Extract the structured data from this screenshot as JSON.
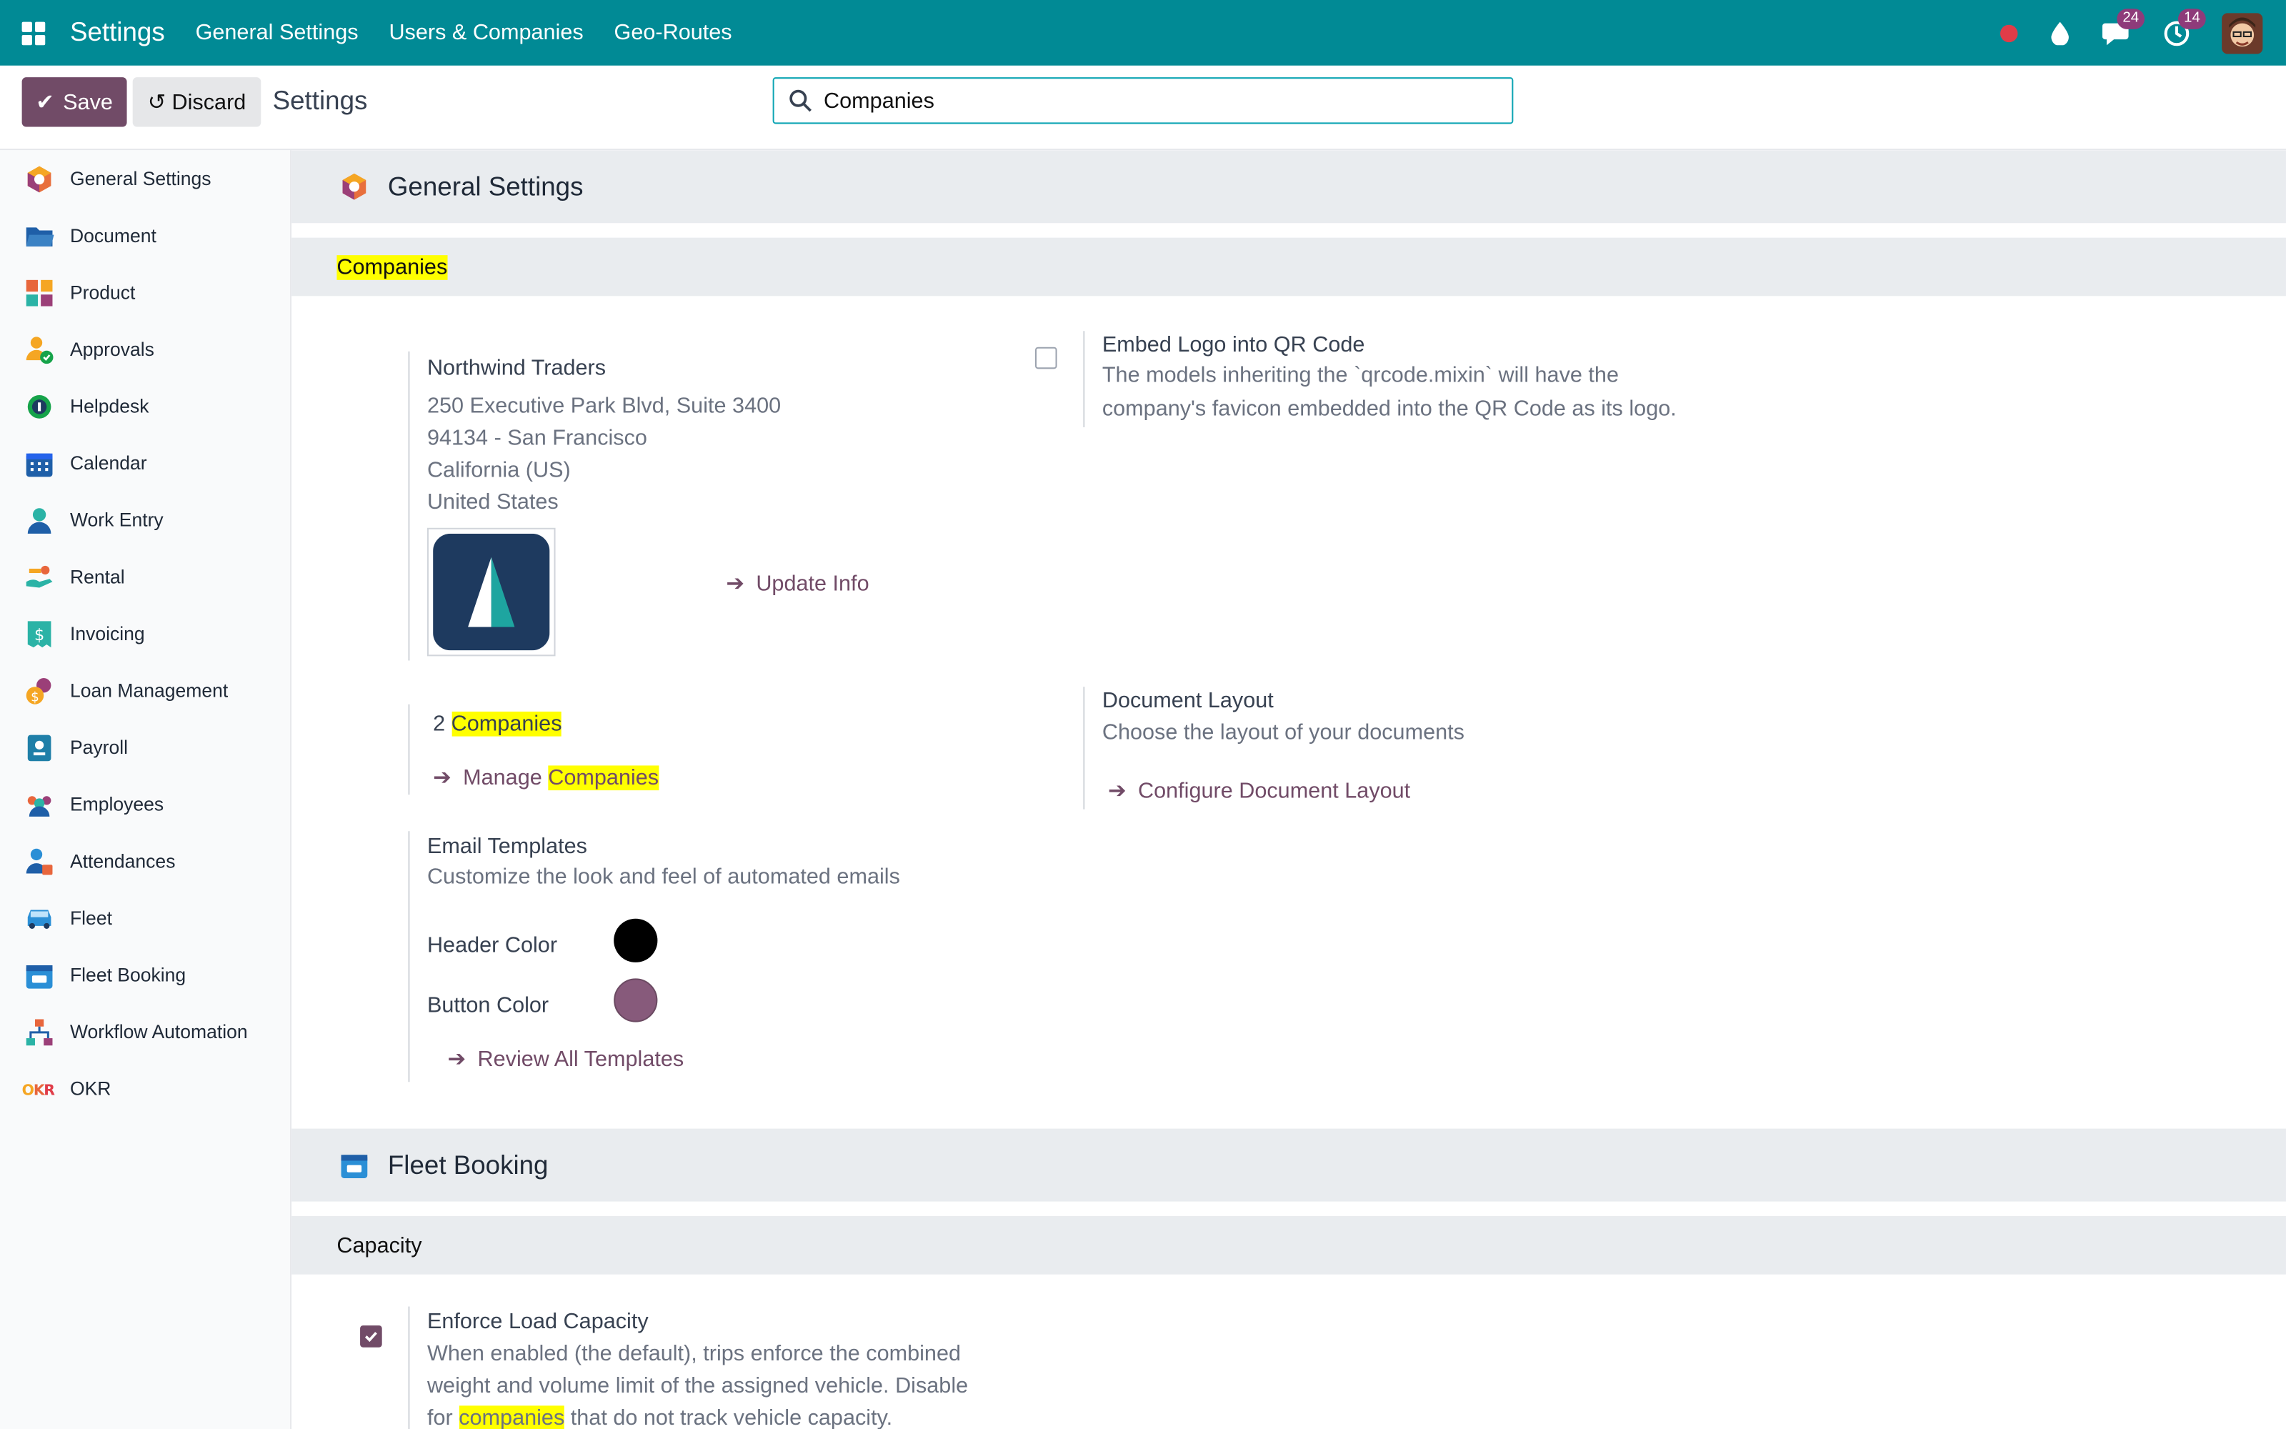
{
  "navbar": {
    "brand": "Settings",
    "menus": [
      "General Settings",
      "Users & Companies",
      "Geo-Routes"
    ],
    "chat_badge": "24",
    "activity_badge": "14",
    "bg_color": "#018a95"
  },
  "control": {
    "save_label": "Save",
    "discard_label": "Discard",
    "title": "Settings",
    "search_value": "Companies"
  },
  "sidebar": {
    "items": [
      {
        "label": "General Settings",
        "icon": "general-settings-icon"
      },
      {
        "label": "Document",
        "icon": "folder-icon"
      },
      {
        "label": "Product",
        "icon": "product-icon"
      },
      {
        "label": "Approvals",
        "icon": "approvals-icon"
      },
      {
        "label": "Helpdesk",
        "icon": "helpdesk-icon"
      },
      {
        "label": "Calendar",
        "icon": "calendar-icon"
      },
      {
        "label": "Work Entry",
        "icon": "work-entry-icon"
      },
      {
        "label": "Rental",
        "icon": "rental-icon"
      },
      {
        "label": "Invoicing",
        "icon": "invoicing-icon"
      },
      {
        "label": "Loan Management",
        "icon": "loan-icon"
      },
      {
        "label": "Payroll",
        "icon": "payroll-icon"
      },
      {
        "label": "Employees",
        "icon": "employees-icon"
      },
      {
        "label": "Attendances",
        "icon": "attendances-icon"
      },
      {
        "label": "Fleet",
        "icon": "fleet-icon"
      },
      {
        "label": "Fleet Booking",
        "icon": "fleet-booking-icon"
      },
      {
        "label": "Workflow Automation",
        "icon": "workflow-icon"
      },
      {
        "label": "OKR",
        "icon": "okr-icon"
      }
    ]
  },
  "general": {
    "title": "General Settings",
    "section_title": "Companies",
    "company": {
      "name": "Northwind Traders",
      "address1": "250 Executive Park Blvd, Suite 3400",
      "address2": "94134 - San Francisco",
      "address3": "California (US)",
      "address4": "United States",
      "update_link": "Update Info"
    },
    "qr": {
      "title": "Embed Logo into QR Code",
      "desc1": "The models inheriting the `qrcode.mixin` will have the",
      "desc2": "company's favicon embedded into the QR Code as its logo.",
      "checked": false
    },
    "companies": {
      "count": "2",
      "count_label": "Companies",
      "manage_prefix": "Manage",
      "manage_hl": "Companies"
    },
    "doc_layout": {
      "title": "Document Layout",
      "desc": "Choose the layout of your documents",
      "link": "Configure Document Layout"
    },
    "email": {
      "title": "Email Templates",
      "desc": "Customize the look and feel of automated emails",
      "header_label": "Header Color",
      "header_color": "#000000",
      "button_label": "Button Color",
      "button_color": "#875a7b",
      "review_link": "Review All Templates"
    }
  },
  "fleet": {
    "title": "Fleet Booking",
    "section_title": "Capacity",
    "enforce": {
      "title": "Enforce Load Capacity",
      "desc1": "When enabled (the default), trips enforce the combined",
      "desc2": "weight and volume limit of the assigned vehicle. Disable",
      "desc3_prefix": "for",
      "desc3_hl": "companies",
      "desc3_suffix": "that do not track vehicle capacity.",
      "checked": true
    }
  }
}
